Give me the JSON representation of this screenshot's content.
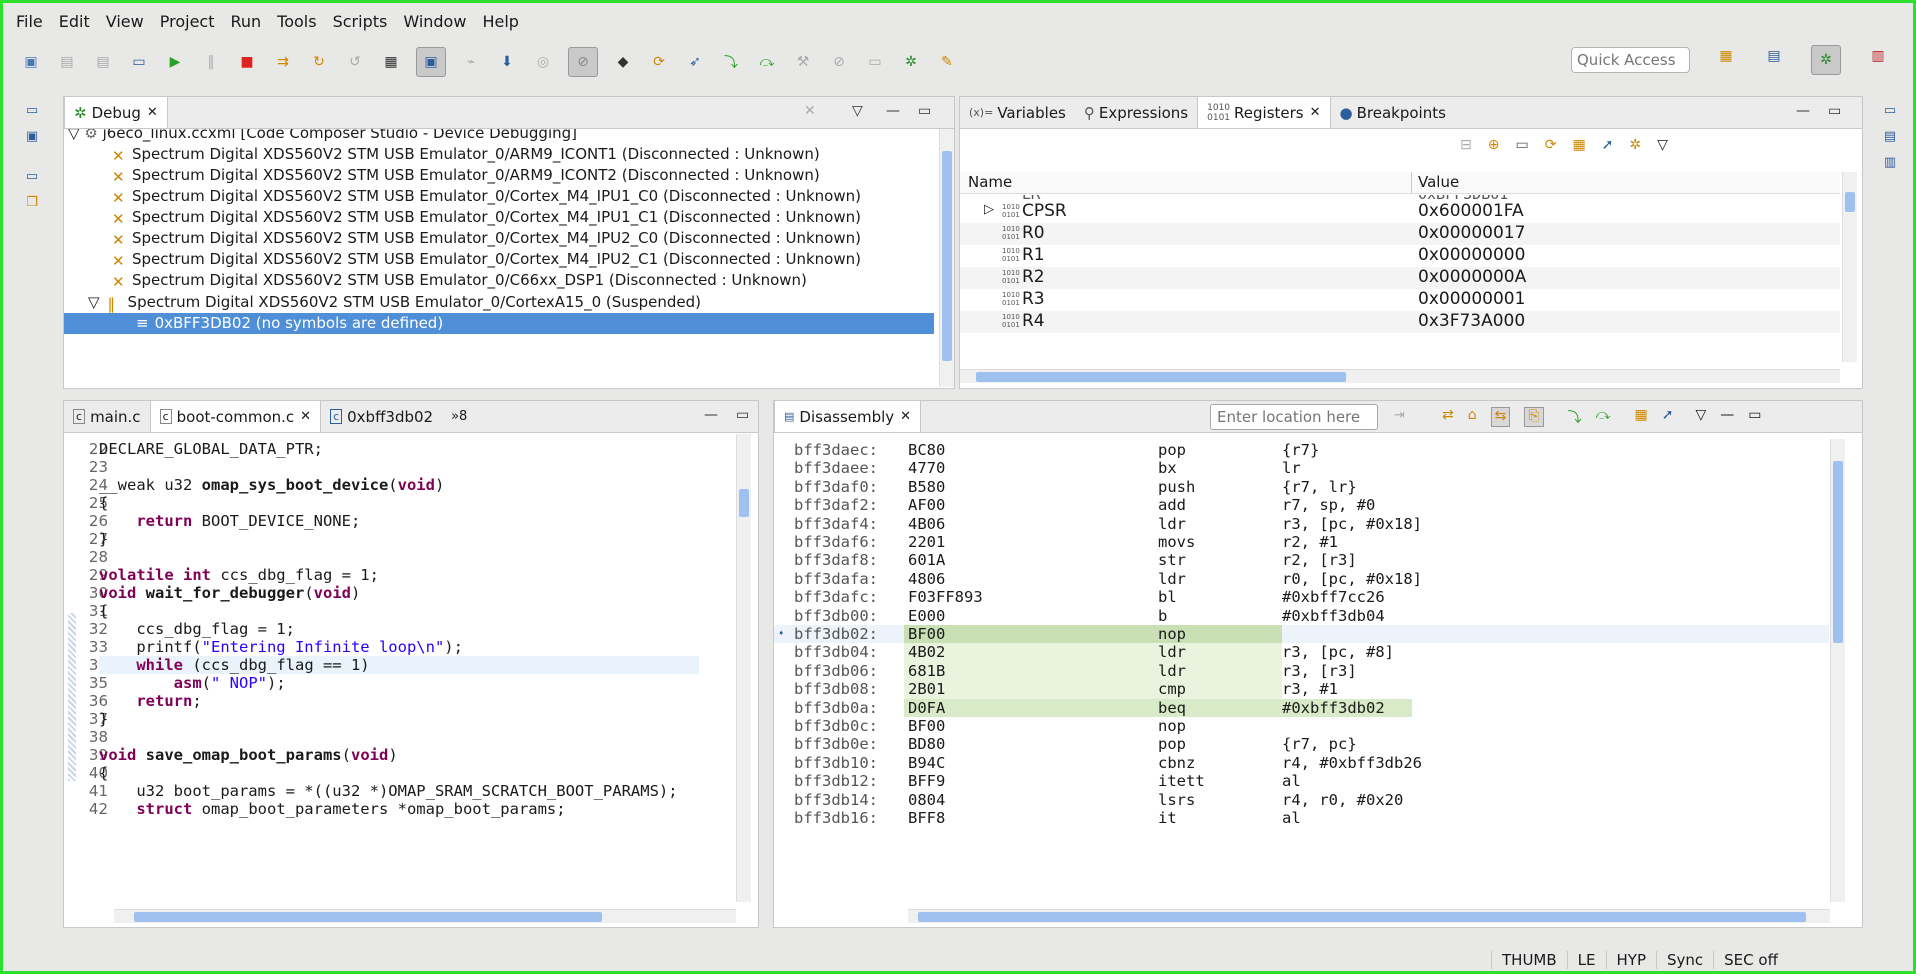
{
  "menu": [
    "File",
    "Edit",
    "View",
    "Project",
    "Run",
    "Tools",
    "Scripts",
    "Window",
    "Help"
  ],
  "quick_access": "Quick Access",
  "debug": {
    "tab": "Debug",
    "root": "j6eco_linux.ccxml [Code Composer Studio - Device Debugging]",
    "items": [
      "Spectrum Digital XDS560V2 STM USB Emulator_0/ARM9_ICONT1 (Disconnected : Unknown)",
      "Spectrum Digital XDS560V2 STM USB Emulator_0/ARM9_ICONT2 (Disconnected : Unknown)",
      "Spectrum Digital XDS560V2 STM USB Emulator_0/Cortex_M4_IPU1_C0 (Disconnected : Unknown)",
      "Spectrum Digital XDS560V2 STM USB Emulator_0/Cortex_M4_IPU1_C1 (Disconnected : Unknown)",
      "Spectrum Digital XDS560V2 STM USB Emulator_0/Cortex_M4_IPU2_C0 (Disconnected : Unknown)",
      "Spectrum Digital XDS560V2 STM USB Emulator_0/Cortex_M4_IPU2_C1 (Disconnected : Unknown)",
      "Spectrum Digital XDS560V2 STM USB Emulator_0/C66xx_DSP1 (Disconnected : Unknown)"
    ],
    "suspended": "Spectrum Digital XDS560V2 STM USB Emulator_0/CortexA15_0 (Suspended)",
    "frame": "0xBFF3DB02  (no symbols are defined)"
  },
  "registers": {
    "tabs": [
      "Variables",
      "Expressions",
      "Registers",
      "Breakpoints"
    ],
    "col_name": "Name",
    "col_value": "Value",
    "rows": [
      {
        "name": "CPSR",
        "value": "0x600001FA"
      },
      {
        "name": "R0",
        "value": "0x00000017"
      },
      {
        "name": "R1",
        "value": "0x00000000"
      },
      {
        "name": "R2",
        "value": "0x0000000A"
      },
      {
        "name": "R3",
        "value": "0x00000001"
      },
      {
        "name": "R4",
        "value": "0x3F73A000"
      }
    ]
  },
  "editor": {
    "tabs": [
      "main.c",
      "boot-common.c",
      "0xbff3db02",
      "»8"
    ],
    "lines": [
      "22",
      "23",
      "24",
      "25",
      "26",
      "27",
      "28",
      "29",
      "30",
      "31",
      "32",
      "33",
      "34",
      "35",
      "36",
      "37",
      "38",
      "39",
      "40",
      "41",
      "42"
    ]
  },
  "disassembly": {
    "tab": "Disassembly",
    "location_placeholder": "Enter location here",
    "rows": [
      {
        "addr": "bff3daec:",
        "op": "BC80",
        "mn": "pop",
        "args": "{r7}"
      },
      {
        "addr": "bff3daee:",
        "op": "4770",
        "mn": "bx",
        "args": "lr"
      },
      {
        "addr": "bff3daf0:",
        "op": "B580",
        "mn": "push",
        "args": "{r7, lr}"
      },
      {
        "addr": "bff3daf2:",
        "op": "AF00",
        "mn": "add",
        "args": "r7, sp, #0"
      },
      {
        "addr": "bff3daf4:",
        "op": "4B06",
        "mn": "ldr",
        "args": "r3, [pc, #0x18]"
      },
      {
        "addr": "bff3daf6:",
        "op": "2201",
        "mn": "movs",
        "args": "r2, #1"
      },
      {
        "addr": "bff3daf8:",
        "op": "601A",
        "mn": "str",
        "args": "r2, [r3]"
      },
      {
        "addr": "bff3dafa:",
        "op": "4806",
        "mn": "ldr",
        "args": "r0, [pc, #0x18]"
      },
      {
        "addr": "bff3dafc:",
        "op": "F03FF893",
        "mn": "bl",
        "args": "#0xbff7cc26"
      },
      {
        "addr": "bff3db00:",
        "op": "E000",
        "mn": "b",
        "args": "#0xbff3db04"
      },
      {
        "addr": "bff3db02:",
        "op": "BF00",
        "mn": "nop",
        "args": ""
      },
      {
        "addr": "bff3db04:",
        "op": "4B02",
        "mn": "ldr",
        "args": "r3, [pc, #8]"
      },
      {
        "addr": "bff3db06:",
        "op": "681B",
        "mn": "ldr",
        "args": "r3, [r3]"
      },
      {
        "addr": "bff3db08:",
        "op": "2B01",
        "mn": "cmp",
        "args": "r3, #1"
      },
      {
        "addr": "bff3db0a:",
        "op": "D0FA",
        "mn": "beq",
        "args": "#0xbff3db02"
      },
      {
        "addr": "bff3db0c:",
        "op": "BF00",
        "mn": "nop",
        "args": ""
      },
      {
        "addr": "bff3db0e:",
        "op": "BD80",
        "mn": "pop",
        "args": "{r7, pc}"
      },
      {
        "addr": "bff3db10:",
        "op": "B94C",
        "mn": "cbnz",
        "args": "r4, #0xbff3db26"
      },
      {
        "addr": "bff3db12:",
        "op": "BFF9",
        "mn": "itett",
        "args": "al"
      },
      {
        "addr": "bff3db14:",
        "op": "0804",
        "mn": "lsrs",
        "args": "r4, r0, #0x20"
      },
      {
        "addr": "bff3db16:",
        "op": "BFF8",
        "mn": "it",
        "args": "al"
      }
    ]
  },
  "status": [
    "THUMB",
    "LE",
    "HYP",
    "Sync",
    "SEC off"
  ]
}
